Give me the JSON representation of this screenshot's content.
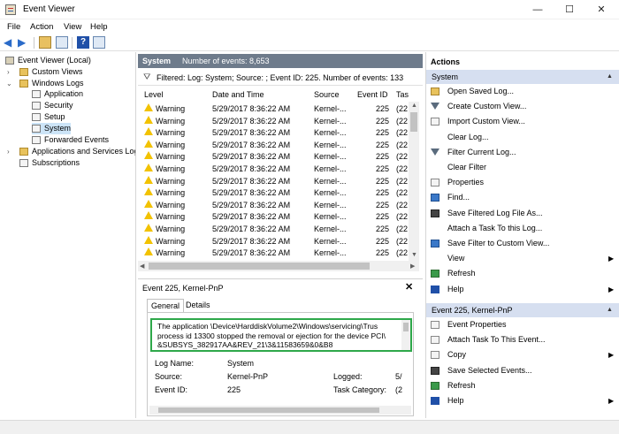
{
  "window": {
    "title": "Event Viewer",
    "controls": {
      "minimize": "—",
      "maximize": "☐",
      "close": "✕"
    }
  },
  "menu": [
    "File",
    "Action",
    "View",
    "Help"
  ],
  "tree": {
    "root": "Event Viewer (Local)",
    "custom_views": "Custom Views",
    "windows_logs": "Windows Logs",
    "application": "Application",
    "security": "Security",
    "setup": "Setup",
    "system": "System",
    "forwarded": "Forwarded Events",
    "apps_services": "Applications and Services Log",
    "subscriptions": "Subscriptions"
  },
  "log_header": {
    "title": "System",
    "count": "Number of events: 8,653"
  },
  "filter_text": "Filtered: Log: System; Source: ; Event ID: 225. Number of events: 133",
  "columns": {
    "level": "Level",
    "datetime": "Date and Time",
    "source": "Source",
    "event_id": "Event ID",
    "task": "Tas"
  },
  "events": [
    {
      "level": "Warning",
      "datetime": "5/29/2017 8:36:22 AM",
      "source": "Kernel-...",
      "event_id": "225",
      "task": "(22"
    },
    {
      "level": "Warning",
      "datetime": "5/29/2017 8:36:22 AM",
      "source": "Kernel-...",
      "event_id": "225",
      "task": "(22"
    },
    {
      "level": "Warning",
      "datetime": "5/29/2017 8:36:22 AM",
      "source": "Kernel-...",
      "event_id": "225",
      "task": "(22"
    },
    {
      "level": "Warning",
      "datetime": "5/29/2017 8:36:22 AM",
      "source": "Kernel-...",
      "event_id": "225",
      "task": "(22"
    },
    {
      "level": "Warning",
      "datetime": "5/29/2017 8:36:22 AM",
      "source": "Kernel-...",
      "event_id": "225",
      "task": "(22"
    },
    {
      "level": "Warning",
      "datetime": "5/29/2017 8:36:22 AM",
      "source": "Kernel-...",
      "event_id": "225",
      "task": "(22"
    },
    {
      "level": "Warning",
      "datetime": "5/29/2017 8:36:22 AM",
      "source": "Kernel-...",
      "event_id": "225",
      "task": "(22"
    },
    {
      "level": "Warning",
      "datetime": "5/29/2017 8:36:22 AM",
      "source": "Kernel-...",
      "event_id": "225",
      "task": "(22"
    },
    {
      "level": "Warning",
      "datetime": "5/29/2017 8:36:22 AM",
      "source": "Kernel-...",
      "event_id": "225",
      "task": "(22"
    },
    {
      "level": "Warning",
      "datetime": "5/29/2017 8:36:22 AM",
      "source": "Kernel-...",
      "event_id": "225",
      "task": "(22"
    },
    {
      "level": "Warning",
      "datetime": "5/29/2017 8:36:22 AM",
      "source": "Kernel-...",
      "event_id": "225",
      "task": "(22"
    },
    {
      "level": "Warning",
      "datetime": "5/29/2017 8:36:22 AM",
      "source": "Kernel-...",
      "event_id": "225",
      "task": "(22"
    },
    {
      "level": "Warning",
      "datetime": "5/29/2017 8:36:22 AM",
      "source": "Kernel-...",
      "event_id": "225",
      "task": "(22"
    }
  ],
  "detail": {
    "title": "Event 225, Kernel-PnP",
    "close": "✕",
    "tab_general": "General",
    "tab_details": "Details",
    "message_lines": [
      "The application \\Device\\HarddiskVolume2\\Windows\\servicing\\Trus",
      "process id 13300 stopped the removal or ejection for the device PCI\\",
      "&SUBSYS_382917AA&REV_21\\3&11583659&0&B8"
    ],
    "log_name_label": "Log Name:",
    "log_name_value": "System",
    "source_label": "Source:",
    "source_value": "Kernel-PnP",
    "logged_label": "Logged:",
    "logged_value": "5/",
    "event_id_label": "Event ID:",
    "event_id_value": "225",
    "task_label": "Task Category:",
    "task_value": "(2"
  },
  "actions": {
    "title": "Actions",
    "system_header": "System",
    "system_items": [
      {
        "label": "Open Saved Log...",
        "icon": "folder-icon"
      },
      {
        "label": "Create Custom View...",
        "icon": "filter-icon"
      },
      {
        "label": "Import Custom View...",
        "icon": "import-icon"
      },
      {
        "label": "Clear Log...",
        "icon": ""
      },
      {
        "label": "Filter Current Log...",
        "icon": "filter-icon"
      },
      {
        "label": "Clear Filter",
        "icon": ""
      },
      {
        "label": "Properties",
        "icon": "properties-icon"
      },
      {
        "label": "Find...",
        "icon": "find-icon"
      },
      {
        "label": "Save Filtered Log File As...",
        "icon": "save-icon"
      },
      {
        "label": "Attach a Task To this Log...",
        "icon": ""
      },
      {
        "label": "Save Filter to Custom View...",
        "icon": "save-filter-icon"
      },
      {
        "label": "View",
        "icon": ""
      },
      {
        "label": "Refresh",
        "icon": "refresh-icon"
      },
      {
        "label": "Help",
        "icon": "help-icon"
      }
    ],
    "event_header": "Event 225, Kernel-PnP",
    "event_items": [
      {
        "label": "Event Properties",
        "icon": "properties-icon"
      },
      {
        "label": "Attach Task To This Event...",
        "icon": "task-icon"
      },
      {
        "label": "Copy",
        "icon": "copy-icon"
      },
      {
        "label": "Save Selected Events...",
        "icon": "save-icon"
      },
      {
        "label": "Refresh",
        "icon": "refresh-icon"
      },
      {
        "label": "Help",
        "icon": "help-icon"
      }
    ]
  }
}
